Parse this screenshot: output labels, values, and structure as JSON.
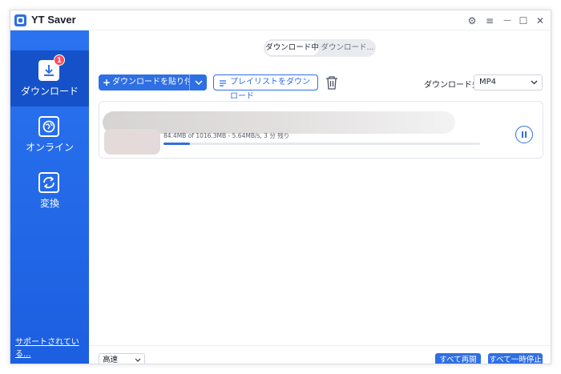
{
  "app": {
    "title": "YT Saver"
  },
  "titlebar": {
    "icons": [
      "gear-icon",
      "menu-icon",
      "minimize-icon",
      "maximize-icon",
      "close-icon"
    ],
    "menu_glyph": "≡",
    "min_glyph": "—",
    "max_glyph": "☐",
    "close_glyph": "✕",
    "gear_glyph": "⚙"
  },
  "sidebar": {
    "items": [
      {
        "label": "ダウンロード",
        "icon": "download-icon",
        "badge": "1"
      },
      {
        "label": "オンライン",
        "icon": "globe-icon"
      },
      {
        "label": "変換",
        "icon": "convert-icon"
      }
    ],
    "support_link": "サポートされている..."
  },
  "tabs": {
    "downloading": "ダウンロード中",
    "downloaded": "ダウンロード..."
  },
  "toolbar": {
    "paste_label": "ダウンロードを貼り付け",
    "playlist_label": "プレイリストをダウンロード",
    "dest_label": "ダウンロード先",
    "dest_value": "MP4"
  },
  "download_item": {
    "progress_text": "84.4MB of 1016.3MB -   5.64MB/s, 3 分 残り",
    "progress_fraction": 0.083
  },
  "footer": {
    "speed_value": "高速",
    "resume_all": "すべて再開",
    "pause_all": "すべて一時停止"
  },
  "colors": {
    "accent": "#2f6fe4",
    "sidebar": "#2a73f0",
    "badge": "#ff4d5a"
  }
}
